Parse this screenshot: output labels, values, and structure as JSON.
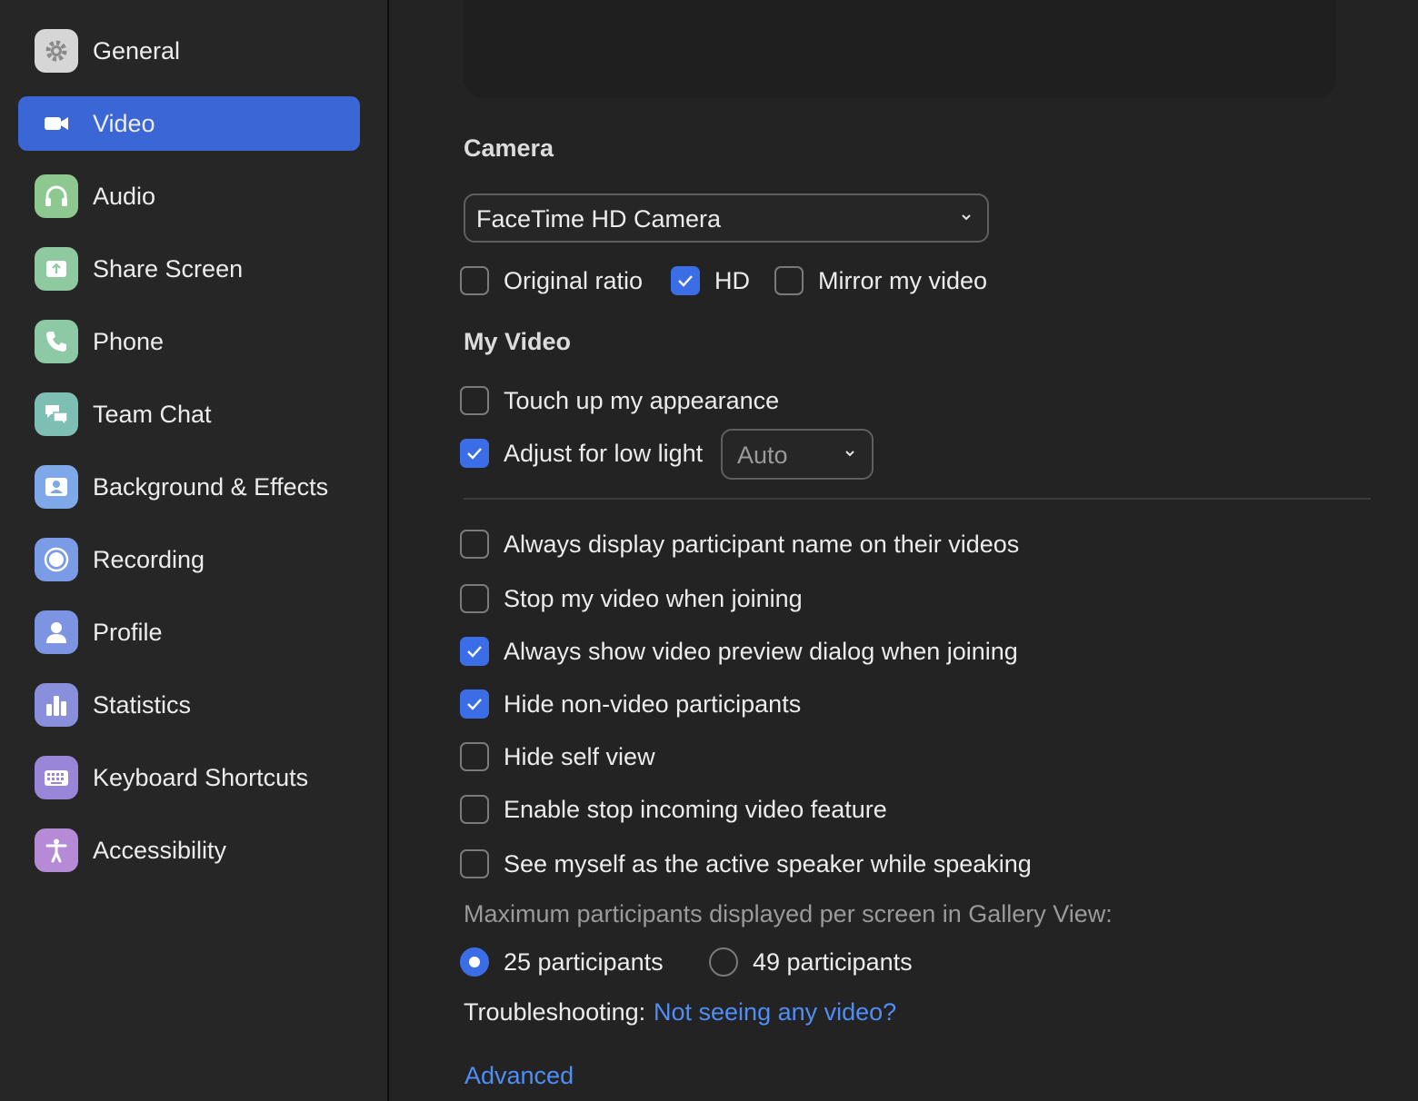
{
  "sidebar": {
    "items": [
      {
        "label": "General",
        "icon": "gear-icon",
        "color": "#d8d8d8",
        "active": false
      },
      {
        "label": "Video",
        "icon": "video-camera-icon",
        "color": "#3a66d6",
        "active": true
      },
      {
        "label": "Audio",
        "icon": "headphones-icon",
        "color": "#8ec891",
        "active": false
      },
      {
        "label": "Share Screen",
        "icon": "share-screen-icon",
        "color": "#8ec9a0",
        "active": false
      },
      {
        "label": "Phone",
        "icon": "phone-icon",
        "color": "#8ec9a6",
        "active": false
      },
      {
        "label": "Team Chat",
        "icon": "chat-bubbles-icon",
        "color": "#7dbfb3",
        "active": false
      },
      {
        "label": "Background & Effects",
        "icon": "background-icon",
        "color": "#7fa8e8",
        "active": false
      },
      {
        "label": "Recording",
        "icon": "record-icon",
        "color": "#7a9be6",
        "active": false
      },
      {
        "label": "Profile",
        "icon": "profile-icon",
        "color": "#7d94e3",
        "active": false
      },
      {
        "label": "Statistics",
        "icon": "bar-chart-icon",
        "color": "#8a8fdc",
        "active": false
      },
      {
        "label": "Keyboard Shortcuts",
        "icon": "keyboard-icon",
        "color": "#9a86d9",
        "active": false
      },
      {
        "label": "Accessibility",
        "icon": "accessibility-icon",
        "color": "#b58ad6",
        "active": false
      }
    ]
  },
  "camera": {
    "title": "Camera",
    "selected_camera": "FaceTime HD Camera",
    "options": [
      {
        "label": "Original ratio",
        "checked": false
      },
      {
        "label": "HD",
        "checked": true
      },
      {
        "label": "Mirror my video",
        "checked": false
      }
    ]
  },
  "my_video": {
    "title": "My Video",
    "touch_up": {
      "label": "Touch up my appearance",
      "checked": false
    },
    "low_light": {
      "label": "Adjust for low light",
      "checked": true,
      "mode": "Auto"
    }
  },
  "settings": [
    {
      "label": "Always display participant name on their videos",
      "checked": false
    },
    {
      "label": "Stop my video when joining",
      "checked": false
    },
    {
      "label": "Always show video preview dialog when joining",
      "checked": true
    },
    {
      "label": "Hide non-video participants",
      "checked": true
    },
    {
      "label": "Hide self view",
      "checked": false
    },
    {
      "label": "Enable stop incoming video feature",
      "checked": false
    },
    {
      "label": "See myself as the active speaker while speaking",
      "checked": false
    }
  ],
  "gallery": {
    "label": "Maximum participants displayed per screen in Gallery View:",
    "options": [
      {
        "label": "25 participants",
        "selected": true
      },
      {
        "label": "49 participants",
        "selected": false
      }
    ]
  },
  "troubleshooting": {
    "label": "Troubleshooting:",
    "link": "Not seeing any video?"
  },
  "advanced_link": "Advanced",
  "colors": {
    "accent": "#3b6ee6",
    "link": "#4f8ef7",
    "background": "#232323"
  }
}
